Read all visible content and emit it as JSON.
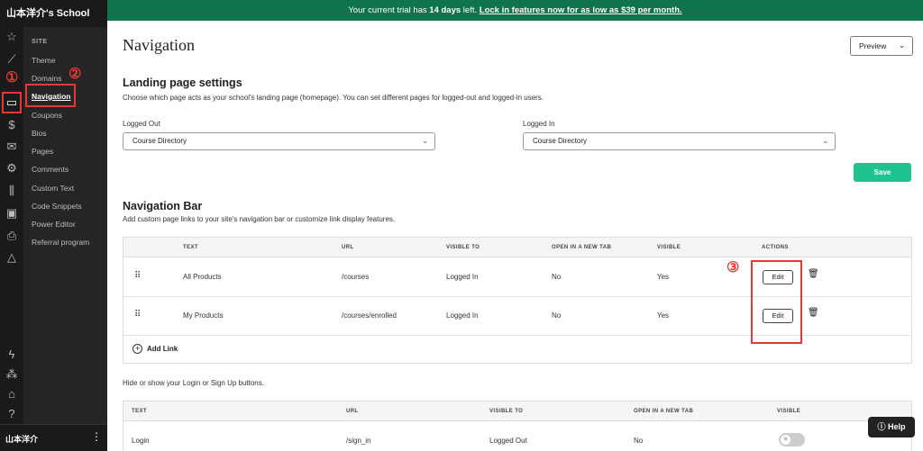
{
  "app": {
    "school_title": "山本洋介's School",
    "user_name": "山本洋介"
  },
  "banner": {
    "text": "Your current trial has ",
    "days": "14 days",
    "text_after": " left. ",
    "link": "Lock in features now for as low as $39 per month."
  },
  "sidebar": {
    "section": "SITE",
    "items": [
      {
        "label": "Theme"
      },
      {
        "label": "Domains"
      },
      {
        "label": "Navigation"
      },
      {
        "label": "Coupons"
      },
      {
        "label": "Bios"
      },
      {
        "label": "Pages"
      },
      {
        "label": "Comments"
      },
      {
        "label": "Custom Text"
      },
      {
        "label": "Code Snippets"
      },
      {
        "label": "Power Editor"
      },
      {
        "label": "Referral program"
      }
    ]
  },
  "markers": {
    "one": "①",
    "two": "②",
    "three": "③"
  },
  "header": {
    "title": "Navigation",
    "preview_label": "Preview"
  },
  "landing": {
    "title": "Landing page settings",
    "description": "Choose which page acts as your school's landing page (homepage). You can set different pages for logged-out and logged-in users.",
    "logged_out_label": "Logged Out",
    "logged_out_value": "Course Directory",
    "logged_in_label": "Logged In",
    "logged_in_value": "Course Directory",
    "save_label": "Save"
  },
  "navbar": {
    "title": "Navigation Bar",
    "description": "Add custom page links to your site's navigation bar or customize link display features.",
    "columns": [
      "TEXT",
      "URL",
      "VISIBLE TO",
      "OPEN IN A NEW TAB",
      "VISIBLE",
      "ACTIONS"
    ],
    "rows": [
      {
        "text": "All Products",
        "url": "/courses",
        "visible_to": "Logged In",
        "new_tab": "No",
        "visible": "Yes",
        "edit": "Edit"
      },
      {
        "text": "My Products",
        "url": "/courses/enrolled",
        "visible_to": "Logged In",
        "new_tab": "No",
        "visible": "Yes",
        "edit": "Edit"
      }
    ],
    "add_link_label": "Add Link"
  },
  "auth": {
    "description": "Hide or show your Login or Sign Up buttons.",
    "columns": [
      "TEXT",
      "URL",
      "VISIBLE TO",
      "OPEN IN A NEW TAB",
      "VISIBLE"
    ],
    "rows": [
      {
        "text": "Login",
        "url": "/sign_in",
        "visible_to": "Logged Out",
        "new_tab": "No",
        "visible": false
      }
    ]
  },
  "help": {
    "label": "Help"
  }
}
